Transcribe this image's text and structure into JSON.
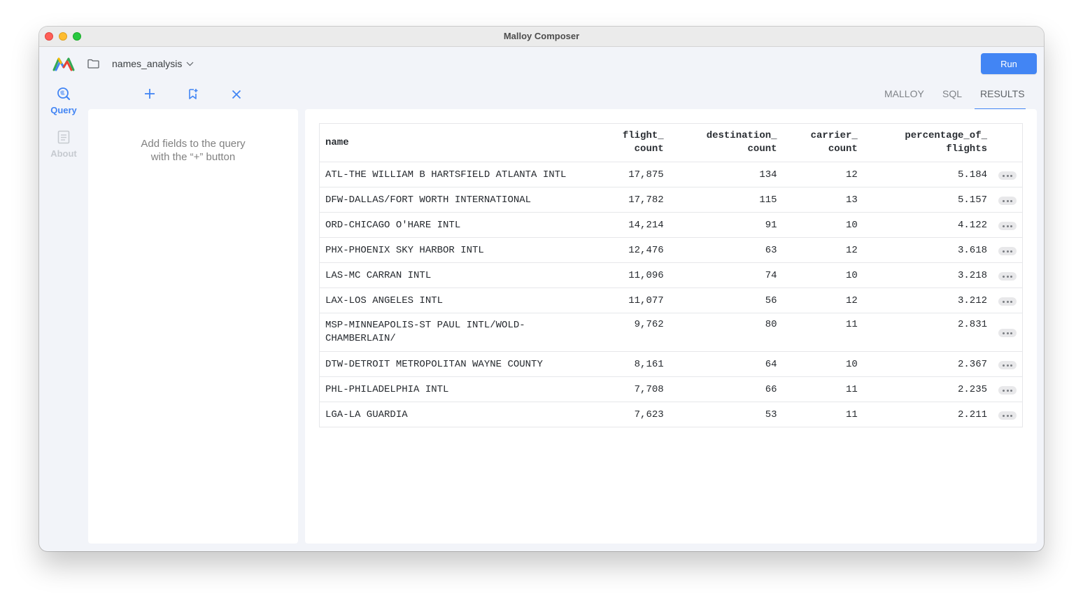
{
  "window": {
    "title": "Malloy Composer"
  },
  "header": {
    "model_name": "names_analysis",
    "run_label": "Run",
    "icons": {
      "logo": "malloy-logo",
      "folder": "folder-icon",
      "chevron": "chevron-down-icon"
    }
  },
  "sidebar": {
    "tabs": [
      {
        "label": "Query",
        "icon": "query-icon",
        "active": true
      },
      {
        "label": "About",
        "icon": "document-icon",
        "active": false
      }
    ]
  },
  "toolbar": {
    "icons": [
      "plus-icon",
      "bookmark-add-icon",
      "close-icon"
    ]
  },
  "query_panel": {
    "hint_line1": "Add fields to the query",
    "hint_line2": "with the “+” button"
  },
  "view_tabs": [
    "MALLOY",
    "SQL",
    "RESULTS"
  ],
  "active_view_tab": "RESULTS",
  "results": {
    "headers": {
      "name": "name",
      "flight_count_1": "flight_",
      "flight_count_2": "count",
      "destination_count_1": "destination_",
      "destination_count_2": "count",
      "carrier_count_1": "carrier_",
      "carrier_count_2": "count",
      "percentage_1": "percentage_of_",
      "percentage_2": "flights"
    },
    "rows": [
      {
        "name": "ATL-THE WILLIAM B HARTSFIELD ATLANTA INTL",
        "flight_count": "17,875",
        "destination_count": "134",
        "carrier_count": "12",
        "percentage_of_flights": "5.184"
      },
      {
        "name": "DFW-DALLAS/FORT WORTH INTERNATIONAL",
        "flight_count": "17,782",
        "destination_count": "115",
        "carrier_count": "13",
        "percentage_of_flights": "5.157"
      },
      {
        "name": "ORD-CHICAGO O'HARE INTL",
        "flight_count": "14,214",
        "destination_count": "91",
        "carrier_count": "10",
        "percentage_of_flights": "4.122"
      },
      {
        "name": "PHX-PHOENIX SKY HARBOR INTL",
        "flight_count": "12,476",
        "destination_count": "63",
        "carrier_count": "12",
        "percentage_of_flights": "3.618"
      },
      {
        "name": "LAS-MC CARRAN INTL",
        "flight_count": "11,096",
        "destination_count": "74",
        "carrier_count": "10",
        "percentage_of_flights": "3.218"
      },
      {
        "name": "LAX-LOS ANGELES INTL",
        "flight_count": "11,077",
        "destination_count": "56",
        "carrier_count": "12",
        "percentage_of_flights": "3.212"
      },
      {
        "name": "MSP-MINNEAPOLIS-ST PAUL INTL/WOLD-CHAMBERLAIN/",
        "flight_count": "9,762",
        "destination_count": "80",
        "carrier_count": "11",
        "percentage_of_flights": "2.831"
      },
      {
        "name": "DTW-DETROIT METROPOLITAN WAYNE COUNTY",
        "flight_count": "8,161",
        "destination_count": "64",
        "carrier_count": "10",
        "percentage_of_flights": "2.367"
      },
      {
        "name": "PHL-PHILADELPHIA INTL",
        "flight_count": "7,708",
        "destination_count": "66",
        "carrier_count": "11",
        "percentage_of_flights": "2.235"
      },
      {
        "name": "LGA-LA GUARDIA",
        "flight_count": "7,623",
        "destination_count": "53",
        "carrier_count": "11",
        "percentage_of_flights": "2.211"
      }
    ]
  },
  "colors": {
    "accent": "#4285f4",
    "background": "#f2f4f9"
  }
}
